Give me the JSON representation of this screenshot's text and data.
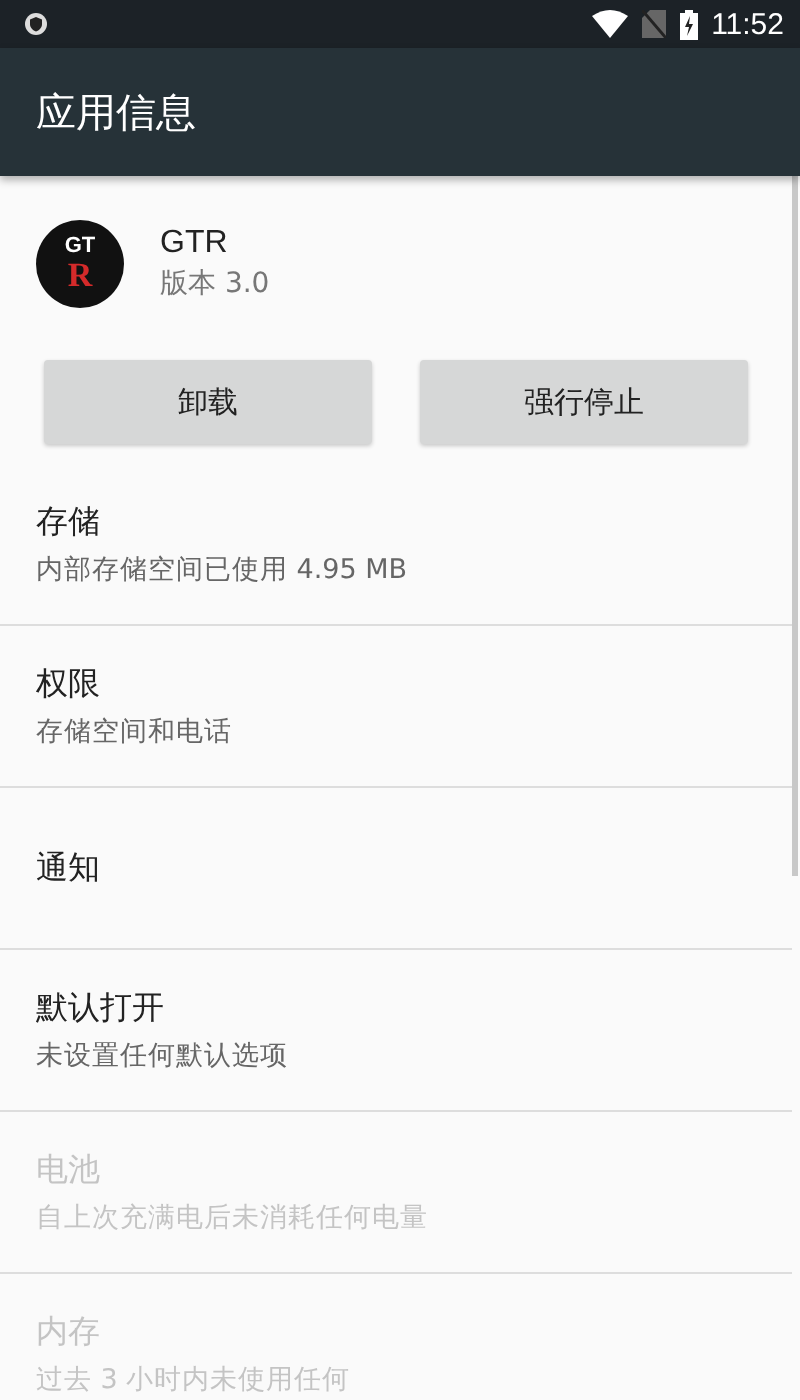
{
  "status_bar": {
    "time": "11:52"
  },
  "toolbar": {
    "title": "应用信息"
  },
  "app": {
    "icon_top": "GT",
    "icon_bottom": "R",
    "name": "GTR",
    "version": "版本 3.0"
  },
  "buttons": [
    "卸载",
    "强行停止"
  ],
  "items": [
    {
      "title": "存储",
      "summary": "内部存储空间已使用 4.95 MB",
      "disabled": false
    },
    {
      "title": "权限",
      "summary": "存储空间和电话",
      "disabled": false
    },
    {
      "title": "通知",
      "disabled": false
    },
    {
      "title": "默认打开",
      "summary": "未设置任何默认选项",
      "disabled": false
    },
    {
      "title": "电池",
      "summary": "自上次充满电后未消耗任何电量",
      "disabled": true
    },
    {
      "title": "内存",
      "summary": "过去 3 小时内未使用任何",
      "disabled": true
    }
  ]
}
